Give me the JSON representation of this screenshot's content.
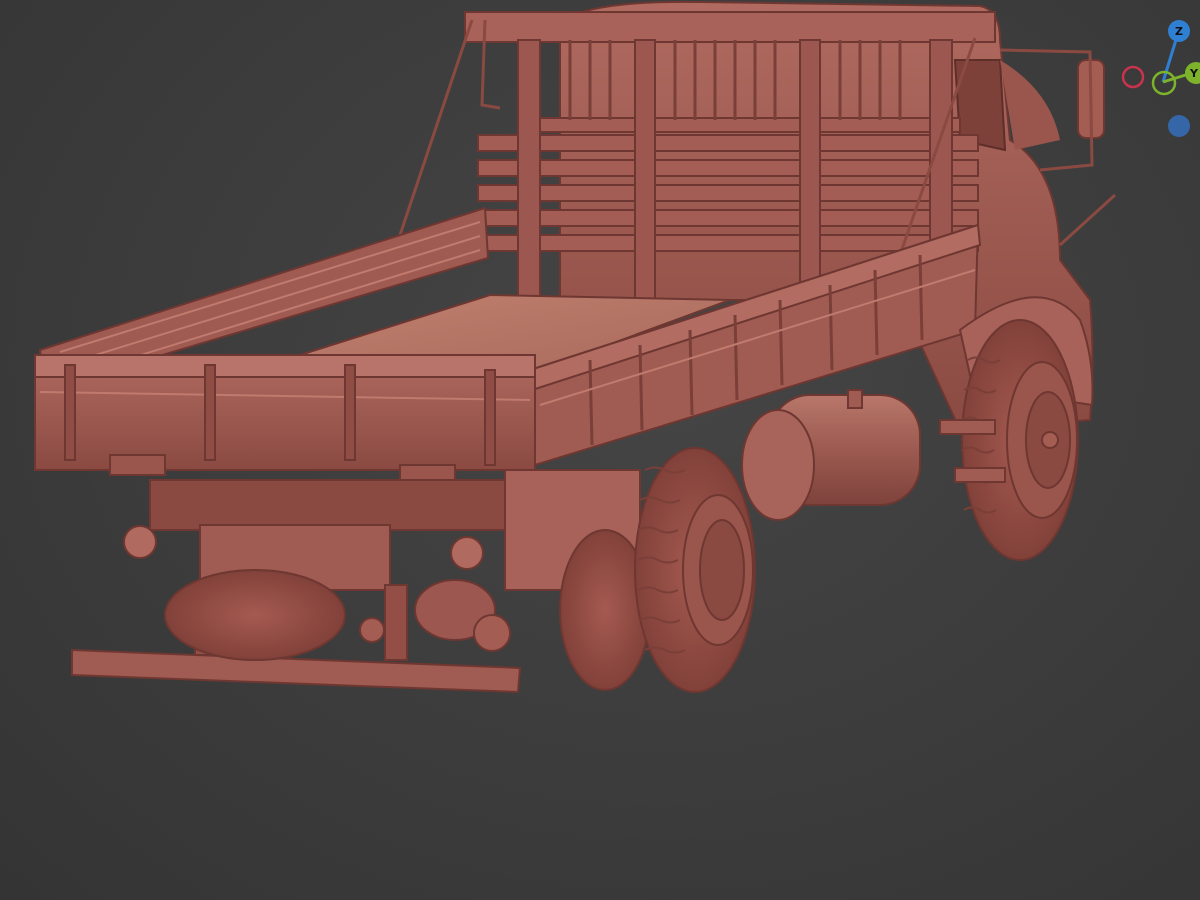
{
  "viewport": {
    "background_color": "#3d3d3d",
    "model_color": "#a0574f"
  },
  "navigation_gizmo": {
    "z_label": "Z",
    "y_label": "Y",
    "z_color": "#2f7fd3",
    "y_color": "#7cb32b",
    "x_color": "#c9334d",
    "neg_y_color": "#6e9f2b",
    "neg_z_color": "#3567a8"
  }
}
